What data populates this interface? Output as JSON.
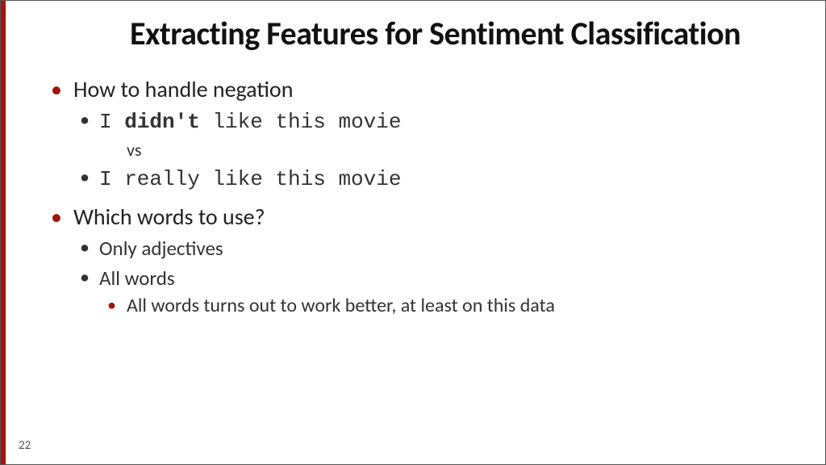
{
  "title": "Extracting Features for Sentiment Classification",
  "items": [
    {
      "text": "How to handle negation",
      "children": [
        {
          "prefix": "I ",
          "bold": "didn't",
          "suffix": " like this movie",
          "mono": true,
          "bulleted": true
        },
        {
          "text": "vs",
          "vs": true
        },
        {
          "text": "I really like this movie",
          "mono": true,
          "bulleted": true
        }
      ]
    },
    {
      "text": "Which words to use?",
      "children": [
        {
          "text": "Only adjectives",
          "bulleted": true
        },
        {
          "text": "All words",
          "bulleted": true,
          "children": [
            {
              "text": "All words turns out to work better, at least on this data"
            }
          ]
        }
      ]
    }
  ],
  "page_number": "22"
}
